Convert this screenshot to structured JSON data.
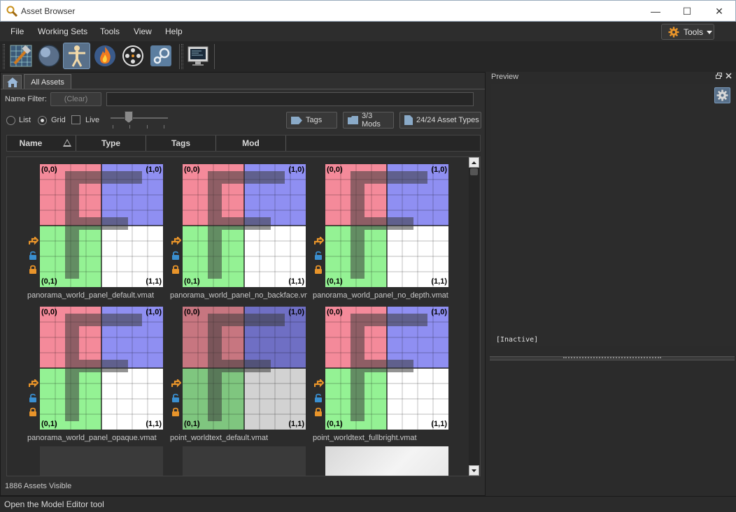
{
  "window": {
    "title": "Asset Browser",
    "app_icon": "magnifier-key-icon",
    "minimize_glyph": "—",
    "maximize_glyph": "☐",
    "close_glyph": "✕"
  },
  "menu": {
    "items": [
      "File",
      "Working Sets",
      "Tools",
      "View",
      "Help"
    ],
    "tools_dropdown": "Tools"
  },
  "toolbar": {
    "buttons": [
      {
        "name": "hammer-editor-icon"
      },
      {
        "name": "material-editor-icon"
      },
      {
        "name": "model-editor-icon",
        "active": true
      },
      {
        "name": "particle-editor-icon"
      },
      {
        "name": "film-reel-icon"
      },
      {
        "name": "steam-icon"
      },
      {
        "name": "console-monitor-icon"
      }
    ]
  },
  "tabs": {
    "home": "home-icon",
    "all_assets": "All Assets"
  },
  "filter": {
    "label": "Name Filter:",
    "clear": "(Clear)",
    "value": ""
  },
  "view_options": {
    "list": "List",
    "grid": "Grid",
    "live": "Live",
    "selected": "Grid",
    "thumb_size_fraction": 0.33
  },
  "filter_buttons": {
    "tags": "Tags",
    "mods": "3/3 Mods",
    "asset_types": "24/24 Asset Types"
  },
  "columns": [
    "Name",
    "Type",
    "Tags",
    "Mod"
  ],
  "thumb_labels": {
    "tl": "(0,0)",
    "tr": "(1,0)",
    "bl": "(0,1)",
    "br": "(1,1)"
  },
  "assets": [
    {
      "name": "panorama_world_panel_default.vmat",
      "dim": false
    },
    {
      "name": "panorama_world_panel_no_backface.vmat",
      "dim": false
    },
    {
      "name": "panorama_world_panel_no_depth.vmat",
      "dim": false
    },
    {
      "name": "panorama_world_panel_opaque.vmat",
      "dim": false
    },
    {
      "name": "point_worldtext_default.vmat",
      "dim": true
    },
    {
      "name": "point_worldtext_fullbright.vmat",
      "dim": false
    }
  ],
  "assets_visible": "1886 Assets Visible",
  "preview": {
    "title": "Preview",
    "status": "[Inactive]"
  },
  "status_bar": "Open the Model Editor tool",
  "colors": {
    "accent": "#58708a",
    "quad_red": "#f48a9a",
    "quad_blue": "#8f8ff2",
    "quad_green": "#94f294",
    "quad_white": "#ffffff",
    "icon_orange": "#e8942a",
    "icon_blue": "#3a8fd0"
  }
}
